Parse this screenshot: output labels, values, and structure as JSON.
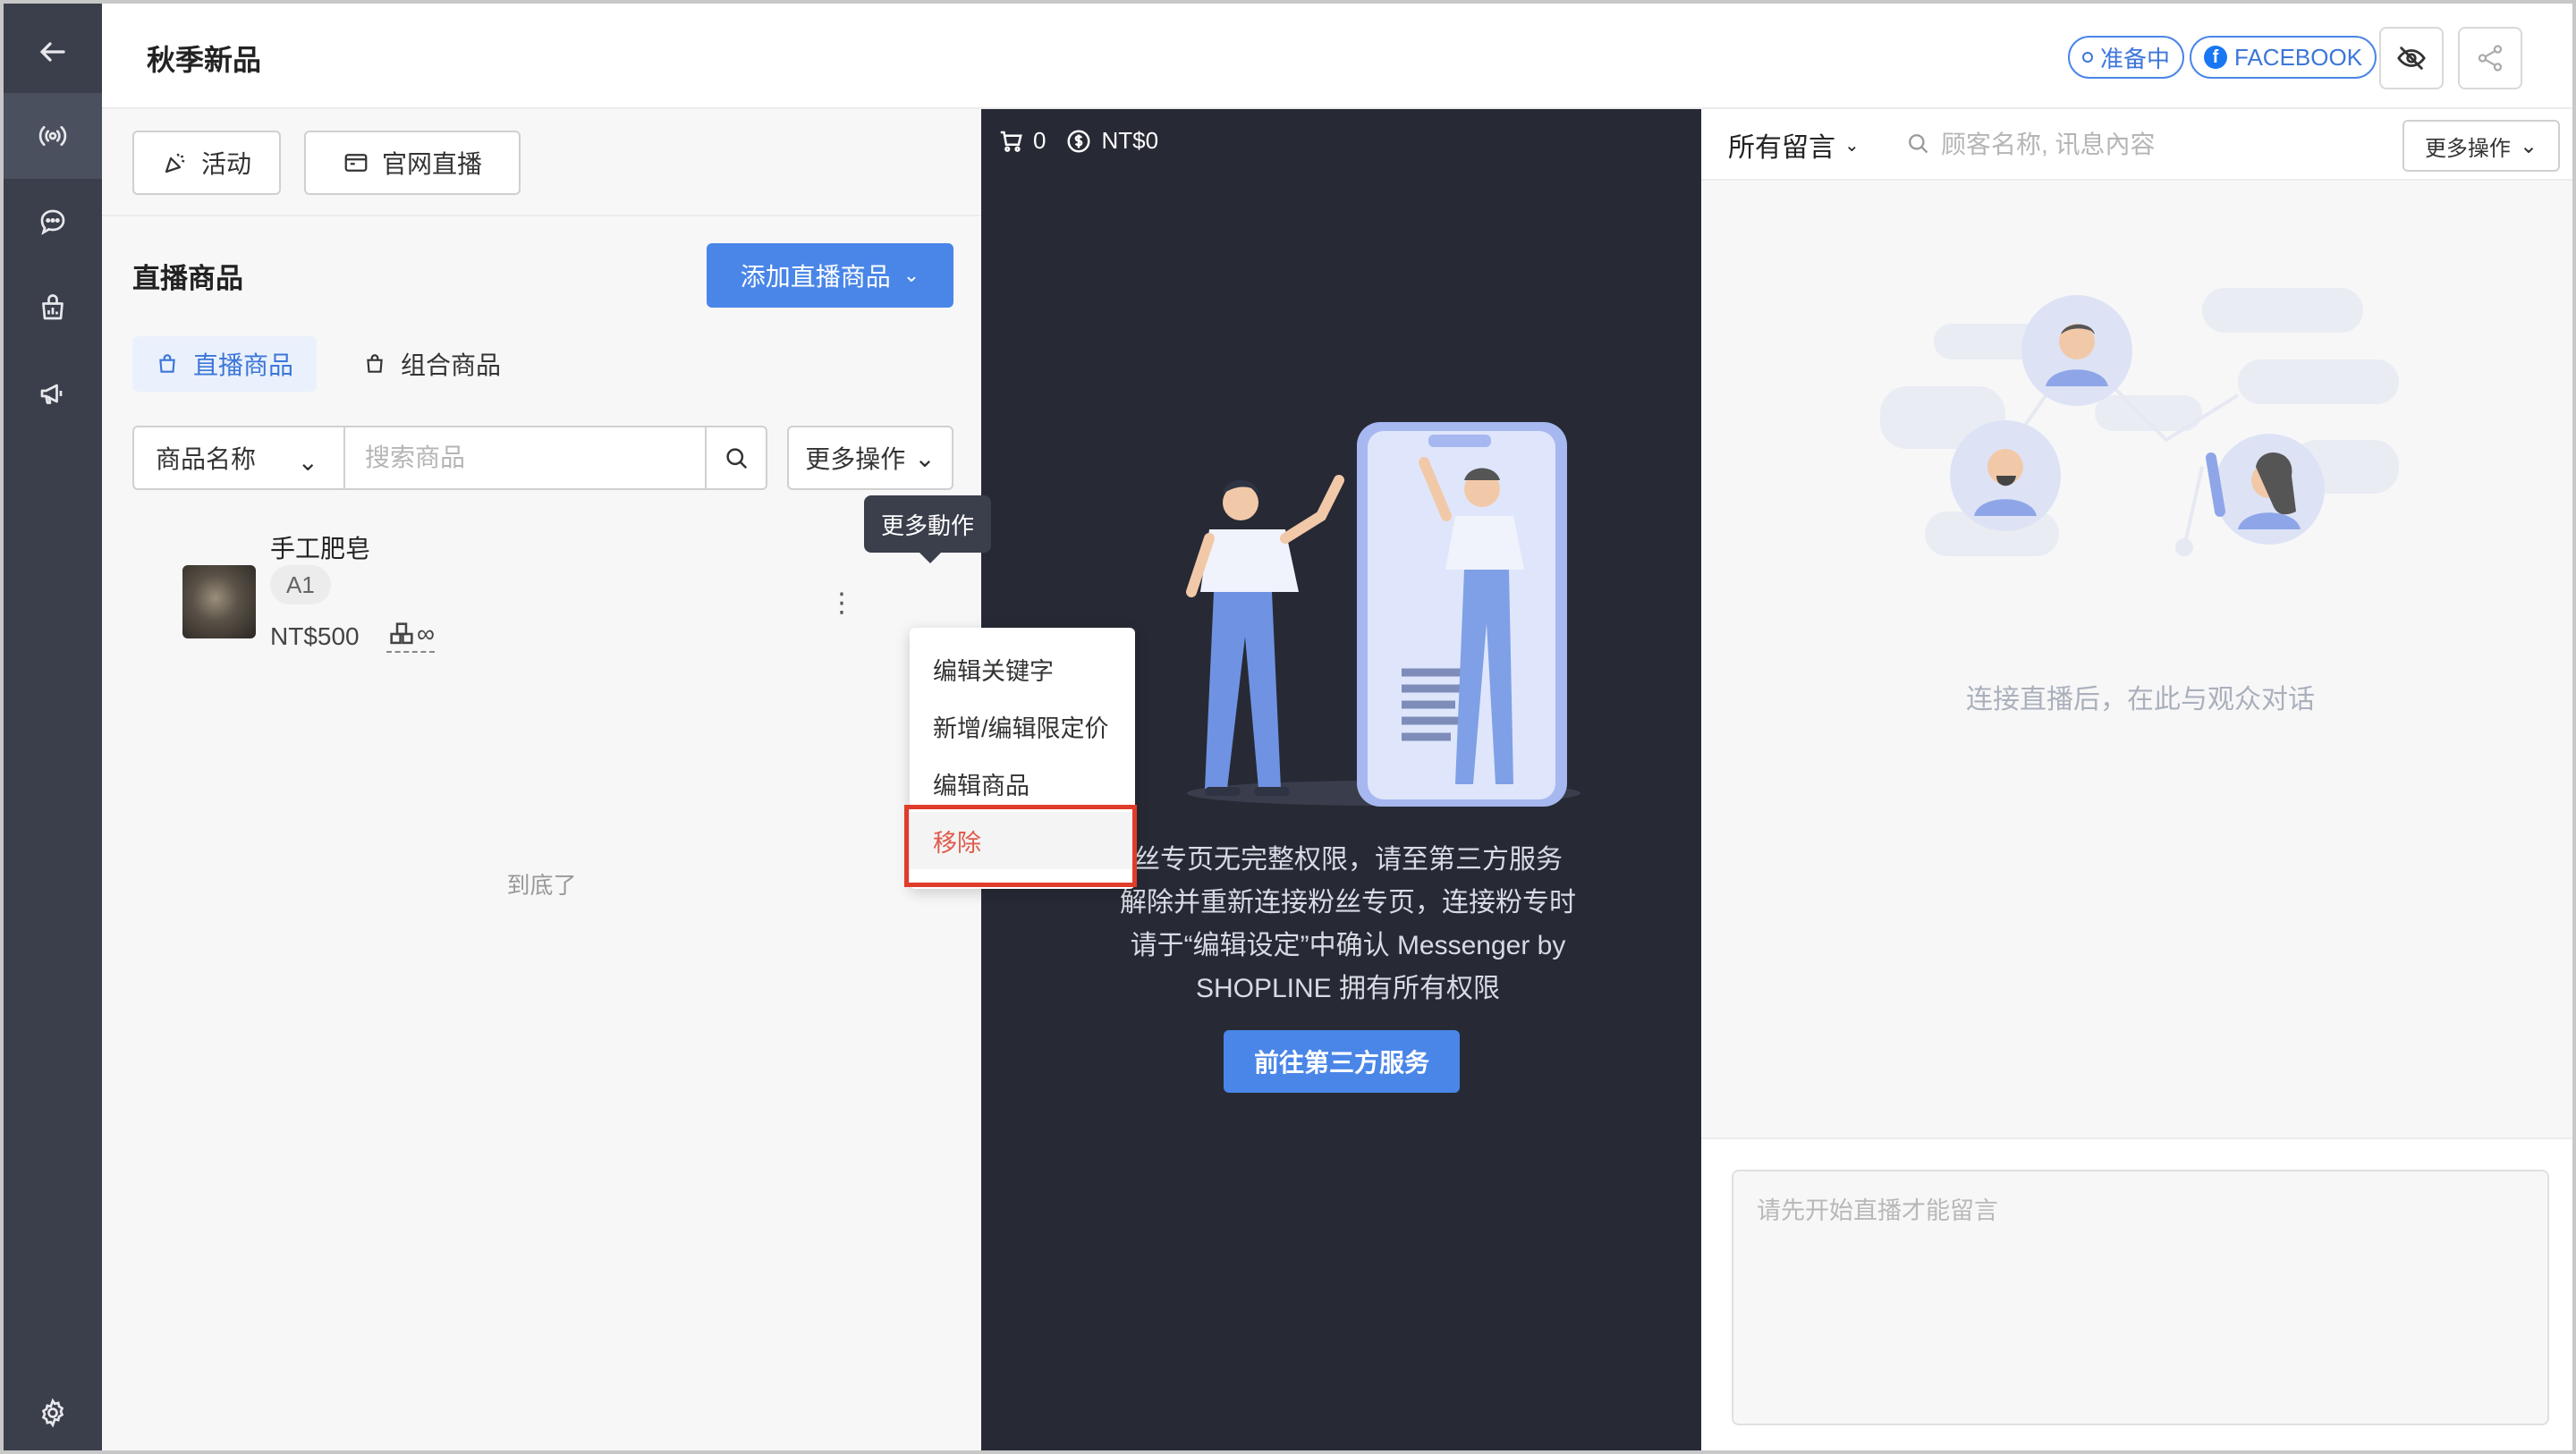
{
  "header": {
    "title": "秋季新品",
    "status_badge": "准备中",
    "platform_badge": "FACEBOOK"
  },
  "left_nav": {
    "items": [
      "back-icon",
      "live-icon",
      "chat-icon",
      "stats-icon",
      "megaphone-icon",
      "gear-icon"
    ]
  },
  "toolbar": {
    "activity_label": "活动",
    "website_live_label": "官网直播"
  },
  "products": {
    "section_title": "直播商品",
    "add_button_label": "添加直播商品",
    "tabs": [
      {
        "label": "直播商品",
        "active": true
      },
      {
        "label": "组合商品",
        "active": false
      }
    ],
    "filter_select": "商品名称",
    "search_placeholder": "搜索商品",
    "more_actions_label": "更多操作",
    "items": [
      {
        "name": "手工肥皂",
        "tag": "A1",
        "price": "NT$500",
        "stock": "∞"
      }
    ],
    "end_text": "到底了"
  },
  "tooltip": {
    "text": "更多動作"
  },
  "menu": {
    "items": [
      {
        "label": "编辑关键字"
      },
      {
        "label": "新增/编辑限定价"
      },
      {
        "label": "编辑商品"
      },
      {
        "label": "移除"
      }
    ]
  },
  "stream": {
    "cart_count": "0",
    "total_amount": "NT$0",
    "message_lines": [
      "丝专页无完整权限，请至第三方服务",
      "解除并重新连接粉丝专页，连接粉专时",
      "请于“编辑设定”中确认 Messenger by",
      "SHOPLINE 拥有所有权限"
    ],
    "action_button_label": "前往第三方服务"
  },
  "comments": {
    "filter_label": "所有留言",
    "search_placeholder": "顾客名称, 讯息內容",
    "more_actions_label": "更多操作",
    "empty_text": "连接直播后，在此与观众对话",
    "input_placeholder": "请先开始直播才能留言"
  },
  "colors": {
    "primary": "#4a86e8",
    "nav_bg": "#3a3f4b",
    "stream_bg": "#272a35",
    "danger": "#e05a4a",
    "highlight": "#e03c2a"
  }
}
